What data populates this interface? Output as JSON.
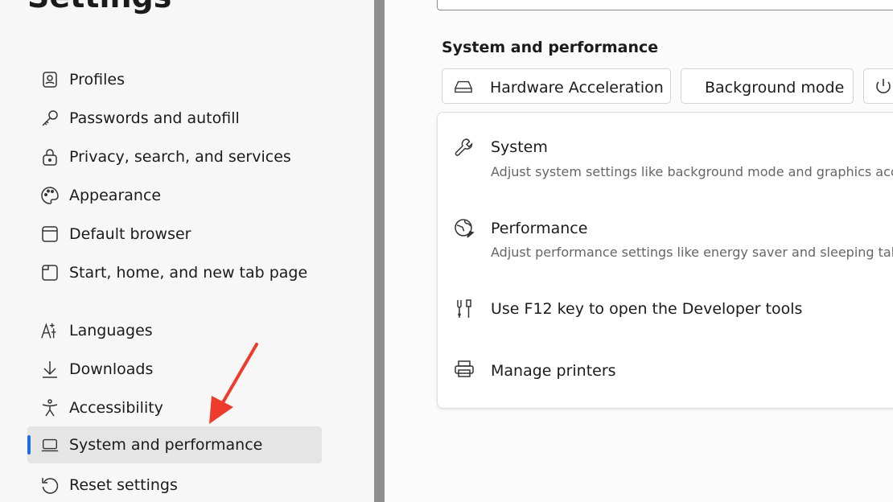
{
  "sidebar": {
    "title": "Settings",
    "items": [
      {
        "label": "Profiles",
        "icon": "profile-icon"
      },
      {
        "label": "Passwords and autofill",
        "icon": "key-icon"
      },
      {
        "label": "Privacy, search, and services",
        "icon": "lock-icon"
      },
      {
        "label": "Appearance",
        "icon": "palette-icon"
      },
      {
        "label": "Default browser",
        "icon": "browser-window-icon"
      },
      {
        "label": "Start, home, and new tab page",
        "icon": "home-tab-icon"
      },
      {
        "label": "Languages",
        "icon": "languages-icon"
      },
      {
        "label": "Downloads",
        "icon": "download-icon"
      },
      {
        "label": "Accessibility",
        "icon": "accessibility-icon"
      },
      {
        "label": "System and performance",
        "icon": "laptop-icon",
        "selected": true
      },
      {
        "label": "Reset settings",
        "icon": "reset-icon"
      }
    ],
    "selected_accent": "#1f6fe0"
  },
  "main": {
    "section_title": "System and performance",
    "quick_buttons": [
      {
        "label": "Hardware Acceleration",
        "icon": "drive-icon"
      },
      {
        "label": "Background mode",
        "icon": ""
      },
      {
        "label": "",
        "icon": "power-icon"
      }
    ],
    "rows": [
      {
        "title": "System",
        "description": "Adjust system settings like background mode and graphics acceleration",
        "icon": "wrench-icon"
      },
      {
        "title": "Performance",
        "description": "Adjust performance settings like energy saver and sleeping tabs",
        "icon": "performance-globe-icon"
      },
      {
        "title": "Use F12 key to open the Developer tools",
        "icon": "developer-tools-icon"
      },
      {
        "title": "Manage printers",
        "icon": "printer-icon"
      }
    ]
  },
  "annotation": {
    "arrow_color": "#ef3b2c",
    "points_to": "System and performance"
  }
}
